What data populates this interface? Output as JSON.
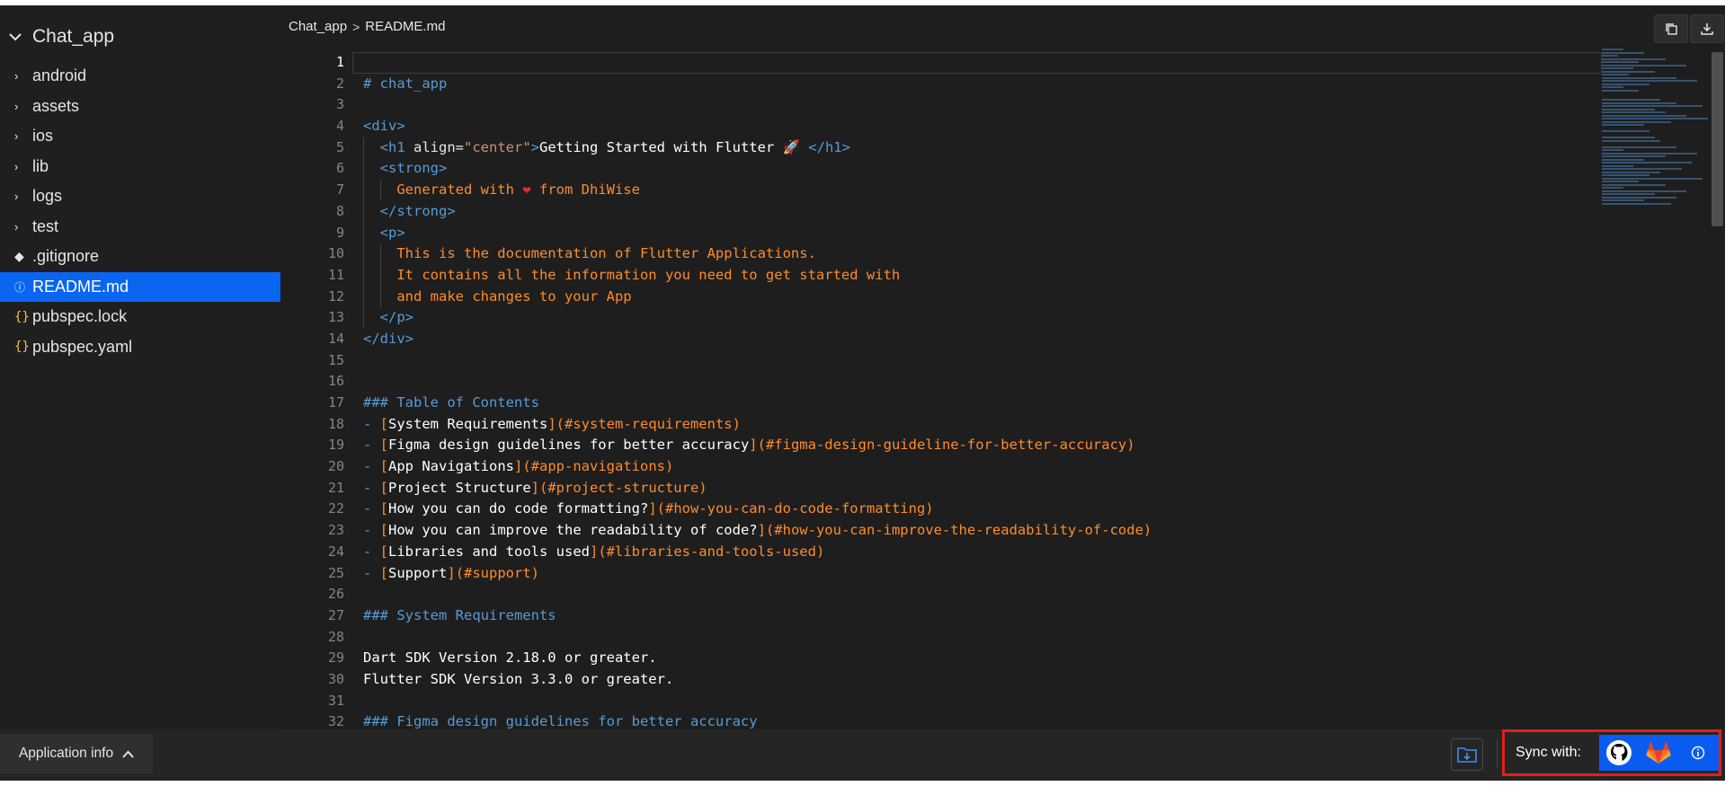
{
  "sidebar": {
    "project": "Chat_app",
    "items": [
      {
        "label": "android",
        "type": "folder"
      },
      {
        "label": "assets",
        "type": "folder"
      },
      {
        "label": "ios",
        "type": "folder"
      },
      {
        "label": "lib",
        "type": "folder"
      },
      {
        "label": "logs",
        "type": "folder"
      },
      {
        "label": "test",
        "type": "folder"
      },
      {
        "label": ".gitignore",
        "type": "git"
      },
      {
        "label": "README.md",
        "type": "info",
        "active": true
      },
      {
        "label": "pubspec.lock",
        "type": "json"
      },
      {
        "label": "pubspec.yaml",
        "type": "json"
      }
    ]
  },
  "breadcrumb": {
    "project": "Chat_app",
    "file": "README.md"
  },
  "editor": {
    "line_numbers": [
      "1",
      "2",
      "3",
      "4",
      "5",
      "6",
      "7",
      "8",
      "9",
      "10",
      "11",
      "12",
      "13",
      "14",
      "15",
      "16",
      "17",
      "18",
      "19",
      "20",
      "21",
      "22",
      "23",
      "24",
      "25",
      "26",
      "27",
      "28",
      "29",
      "30",
      "31",
      "32"
    ],
    "current_line": 1,
    "lines": {
      "l2": "# chat_app",
      "l4": "<div>",
      "l5a": "<h1 ",
      "l5b": "align",
      "l5c": "=",
      "l5d": "\"center\"",
      "l5e": ">",
      "l5f": "Getting Started with Flutter ",
      "l5g": "🚀",
      "l5h": " </h1>",
      "l6": "<strong>",
      "l7a": "Generated with ",
      "l7b": "❤",
      "l7c": " from DhiWise",
      "l8": "</strong>",
      "l9": "<p>",
      "l10": "This is the documentation of Flutter Applications.",
      "l11": "It contains all the information you need to get started with",
      "l12": "and make changes to your App",
      "l13": "</p>",
      "l14": "</div>",
      "l17": "### Table of Contents",
      "toc": [
        {
          "text": "System Requirements",
          "anchor": "(#system-requirements)"
        },
        {
          "text": "Figma design guidelines for better accuracy",
          "anchor": "(#figma-design-guideline-for-better-accuracy)"
        },
        {
          "text": "App Navigations",
          "anchor": "(#app-navigations)"
        },
        {
          "text": "Project Structure",
          "anchor": "(#project-structure)"
        },
        {
          "text": "How you can do code formatting?",
          "anchor": "(#how-you-can-do-code-formatting)"
        },
        {
          "text": "How you can improve the readability of code?",
          "anchor": "(#how-you-can-improve-the-readability-of-code)"
        },
        {
          "text": "Libraries and tools used",
          "anchor": "(#libraries-and-tools-used)"
        },
        {
          "text": "Support",
          "anchor": "(#support)"
        }
      ],
      "l27": "### System Requirements",
      "l29": "Dart SDK Version 2.18.0 or greater.",
      "l30": "Flutter SDK Version 3.3.0 or greater.",
      "l32": "### Figma design guidelines for better accuracy"
    }
  },
  "bottom": {
    "app_info_label": "Application info",
    "sync_label": "Sync with:"
  },
  "colors": {
    "accent": "#0a66f0",
    "sync_border": "#e0211b",
    "markdown_keyword": "#569cd6",
    "string_text": "#ff8c2a"
  },
  "icons": {
    "top_left": "copy-icon",
    "top_right": "download-icon",
    "sync_providers": [
      "github-icon",
      "gitlab-icon",
      "info-icon"
    ]
  }
}
